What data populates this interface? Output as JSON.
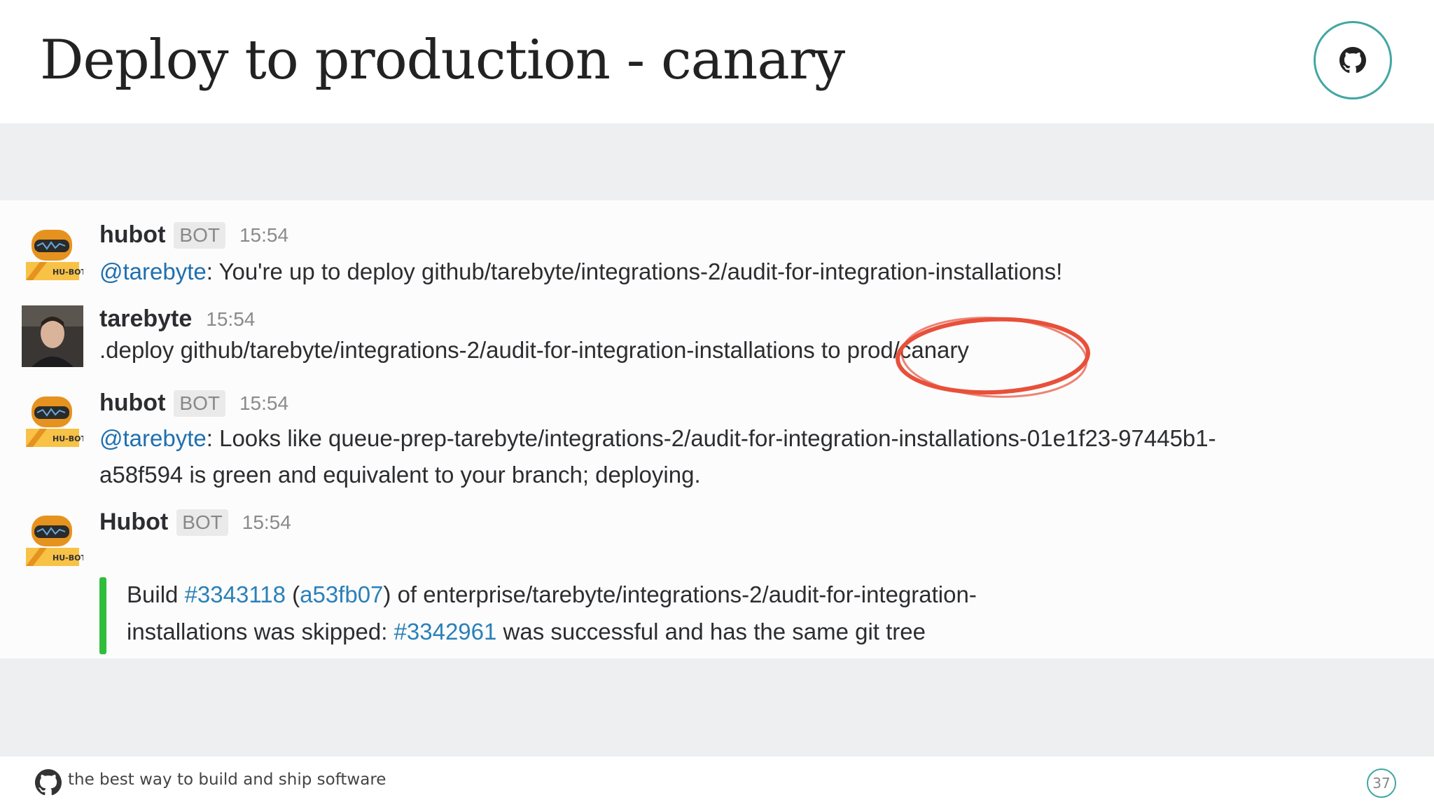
{
  "slide": {
    "title": "Deploy to production - canary",
    "footer_tagline": "the best way to build and ship software",
    "page_number": "37"
  },
  "messages": [
    {
      "author": "hubot",
      "bot_tag": "BOT",
      "time": "15:54",
      "avatar": "hubot-robot-avatar",
      "body": {
        "mention": "@tarebyte",
        "text": ": You're up to deploy github/tarebyte/integrations-2/audit-for-integration-installations!"
      }
    },
    {
      "author": "tarebyte",
      "time": "15:54",
      "avatar": "user-photo-avatar",
      "body": {
        "text": ".deploy github/tarebyte/integrations-2/audit-for-integration-installations to prod/canary"
      }
    },
    {
      "author": "hubot",
      "bot_tag": "BOT",
      "time": "15:54",
      "avatar": "hubot-robot-avatar",
      "body": {
        "mention": "@tarebyte",
        "line1": ": Looks like queue-prep-tarebyte/integrations-2/audit-for-integration-installations-01e1f23-97445b1-",
        "line2": "a58f594 is green and equivalent to your branch; deploying."
      }
    },
    {
      "author": "Hubot",
      "bot_tag": "BOT",
      "time": "15:54",
      "avatar": "hubot-robot-avatar",
      "attachment": {
        "color": "#2fbd3b",
        "prefix": "Build ",
        "build_link": "#3343118",
        "paren_open": " (",
        "sha_link": "a53fb07",
        "rest1": ") of enterprise/tarebyte/integrations-2/audit-for-integration-",
        "line2_prefix": "installations was skipped: ",
        "prev_build_link": "#3342961",
        "line2_rest": " was successful and has the same git tree"
      }
    }
  ],
  "colors": {
    "accent_ring": "#43a6a3",
    "mention": "#1f6fb0",
    "link": "#2a80b9",
    "annotation_circle": "#e8503a",
    "attachment_bar": "#2fbd3b"
  }
}
